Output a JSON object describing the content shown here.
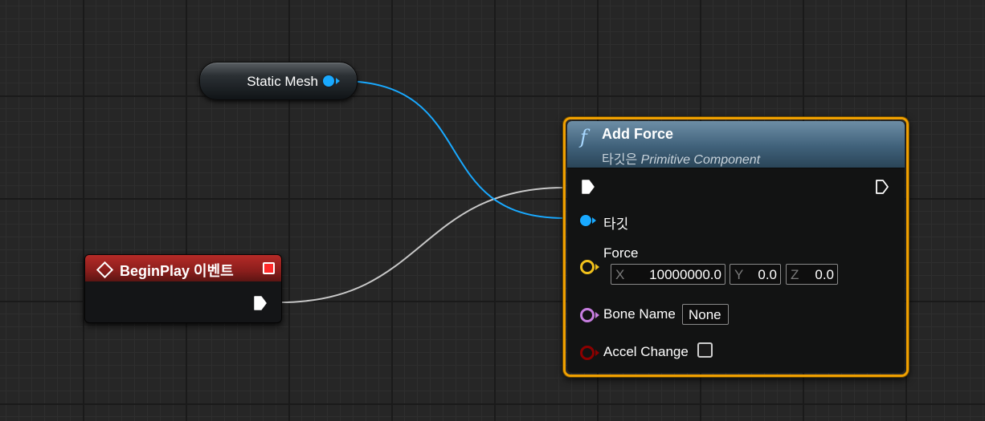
{
  "variable_node": {
    "label": "Static Mesh",
    "pin_color": "#19a9ff"
  },
  "event_node": {
    "title": "BeginPlay 이벤트",
    "header_color": "#9e2422",
    "icon": "event-diamond-icon"
  },
  "function_node": {
    "icon": "function-icon",
    "icon_glyph": "f",
    "title": "Add Force",
    "subtitle_prefix": "타깃은",
    "subtitle_target": "Primitive Component",
    "border_color": "#f0a000",
    "pins": {
      "target_label": "타깃",
      "force_label": "Force",
      "force": {
        "x_axis": "X",
        "x_value": "10000000.0",
        "y_axis": "Y",
        "y_value": "0.0",
        "z_axis": "Z",
        "z_value": "0.0"
      },
      "bone_name_label": "Bone Name",
      "bone_name_value": "None",
      "accel_change_label": "Accel Change",
      "accel_change_checked": false
    }
  },
  "colors": {
    "object_pin": "#19a9ff",
    "vector_pin": "#f1c11b",
    "name_pin": "#c77ee0",
    "bool_pin": "#8c0000",
    "exec_pin": "#ffffff",
    "object_wire": "#19a9ff",
    "exec_wire": "#c8c8c8"
  }
}
